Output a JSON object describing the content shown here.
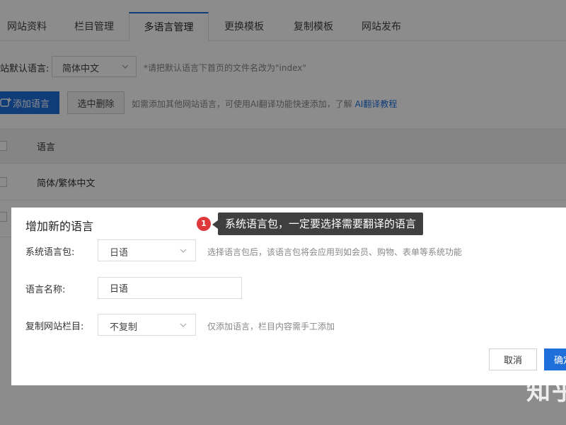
{
  "tabs": [
    {
      "label": "网站资料",
      "active": false
    },
    {
      "label": "栏目管理",
      "active": false
    },
    {
      "label": "多语言管理",
      "active": true
    },
    {
      "label": "更换模板",
      "active": false
    },
    {
      "label": "复制模板",
      "active": false
    },
    {
      "label": "网站发布",
      "active": false
    }
  ],
  "default_lang": {
    "label": "站默认语言:",
    "value": "简体中文",
    "hint": "*请把默认语言下首页的文件名改为\"index\""
  },
  "actions": {
    "add_label": "添加语言",
    "delete_label": "选中删除",
    "hint": "如需添加其他网站语言，可使用AI翻译功能快速添加，了解",
    "link_label": "AI翻译教程"
  },
  "table": {
    "header": "语言",
    "rows": [
      {
        "name": "简体/繁体中文"
      }
    ]
  },
  "dialog": {
    "title": "增加新的语言",
    "pack_label": "系统语言包:",
    "pack_value": "日语",
    "pack_hint": "选择语言包后，该语言包将会应用到如会员、购物、表单等系统功能",
    "name_label": "语言名称:",
    "name_value": "日语",
    "copy_label": "复制网站栏目:",
    "copy_value": "不复制",
    "copy_hint": "仅添加语言，栏目内容需手工添加",
    "cancel_label": "取消",
    "ok_label": "确定"
  },
  "tooltip": {
    "badge": "1",
    "text": "系统语言包，一定要选择需要翻译的语言"
  },
  "watermark": "知乎",
  "colors": {
    "accent": "#1e6fd9",
    "badge": "#e0373a",
    "tooltip_bg": "#3f3f3f"
  }
}
